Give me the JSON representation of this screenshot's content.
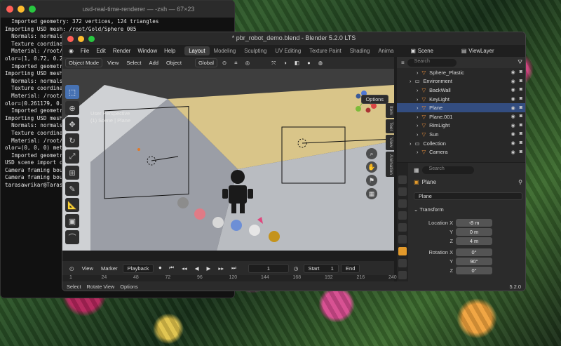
{
  "terminal": {
    "title": "usd-real-time-renderer — -zsh — 67×23",
    "lines": [
      "  Imported geometry: 372 vertices, 124 triangles",
      "Importing USD mesh: /root/Gold/Sphere_005",
      "  Normals: normals attribute, faceVarying interpolation",
      "  Texture coordina",
      "  Material: /root/",
      "olor=(1, 0.72, 0.2",
      "  Imported geometr",
      "Importing USD mesh",
      "  Normals: normals",
      "  Texture coordina",
      "  Material: /root/",
      "olor=(0.261179, 0.",
      "  Imported geometr",
      "Importing USD mesh",
      "  Normals: normals",
      "  Texture coordina",
      "  Material: /root/",
      "olor=(0, 0, 0) met",
      "  Imported geometr",
      "USD scene import c",
      "Camera framing bou",
      "Camera framing bou",
      "tarasawrikar@Taras"
    ]
  },
  "blender": {
    "title": "* pbr_robot_demo.blend - Blender 5.2.0 LTS",
    "menu": [
      "File",
      "Edit",
      "Render",
      "Window",
      "Help"
    ],
    "workspaces": [
      "Layout",
      "Modeling",
      "Sculpting",
      "UV Editing",
      "Texture Paint",
      "Shading",
      "Anima"
    ],
    "scene": "Scene",
    "view_layer": "ViewLayer",
    "viewport": {
      "mode": "Object Mode",
      "menus": [
        "View",
        "Select",
        "Add",
        "Object"
      ],
      "transform_orientation": "Global",
      "options": "Options",
      "overlay_title": "User Perspective",
      "overlay_subtitle": "(1) Scene | Plane",
      "side_tabs": [
        "Item",
        "Tool",
        "View",
        "Animation"
      ]
    },
    "timeline": {
      "playback": "Playback",
      "marker": "Marker",
      "view": "View",
      "current_frame": "1",
      "start_label": "Start",
      "start": "1",
      "end_label": "End",
      "ruler": [
        "1",
        "24",
        "48",
        "72",
        "96",
        "120",
        "144",
        "168",
        "192",
        "216",
        "240"
      ]
    },
    "status": {
      "select": "Select",
      "rotate": "Rotate View",
      "options": "Options",
      "version": "5.2.0"
    },
    "outliner": {
      "search_placeholder": "Search",
      "rows": [
        {
          "label": "Sphere_Plastic",
          "indent": 2,
          "color": "#e08a3c"
        },
        {
          "label": "Environment",
          "indent": 1,
          "color": "#c9c9c9"
        },
        {
          "label": "BackWall",
          "indent": 2,
          "color": "#e08a3c"
        },
        {
          "label": "KeyLight",
          "indent": 2,
          "color": "#e08a3c"
        },
        {
          "label": "Plane",
          "indent": 2,
          "color": "#e08a3c"
        },
        {
          "label": "Plane.001",
          "indent": 2,
          "color": "#e08a3c"
        },
        {
          "label": "RimLight",
          "indent": 2,
          "color": "#e08a3c"
        },
        {
          "label": "Sun",
          "indent": 2,
          "color": "#e08a3c"
        },
        {
          "label": "Collection",
          "indent": 1,
          "color": "#c9c9c9"
        },
        {
          "label": "Camera",
          "indent": 2,
          "color": "#e08a3c"
        }
      ]
    },
    "properties": {
      "search_placeholder": "Search",
      "object_name": "Plane",
      "data_name": "Plane",
      "section": "Transform",
      "location": {
        "label": "Location",
        "x": "-8 m",
        "y": "0 m",
        "z": "4 m"
      },
      "rotation": {
        "label": "Rotation",
        "x": "0°",
        "y": "90°",
        "z": "0°"
      },
      "axes": [
        "X",
        "Y",
        "Z"
      ]
    }
  }
}
